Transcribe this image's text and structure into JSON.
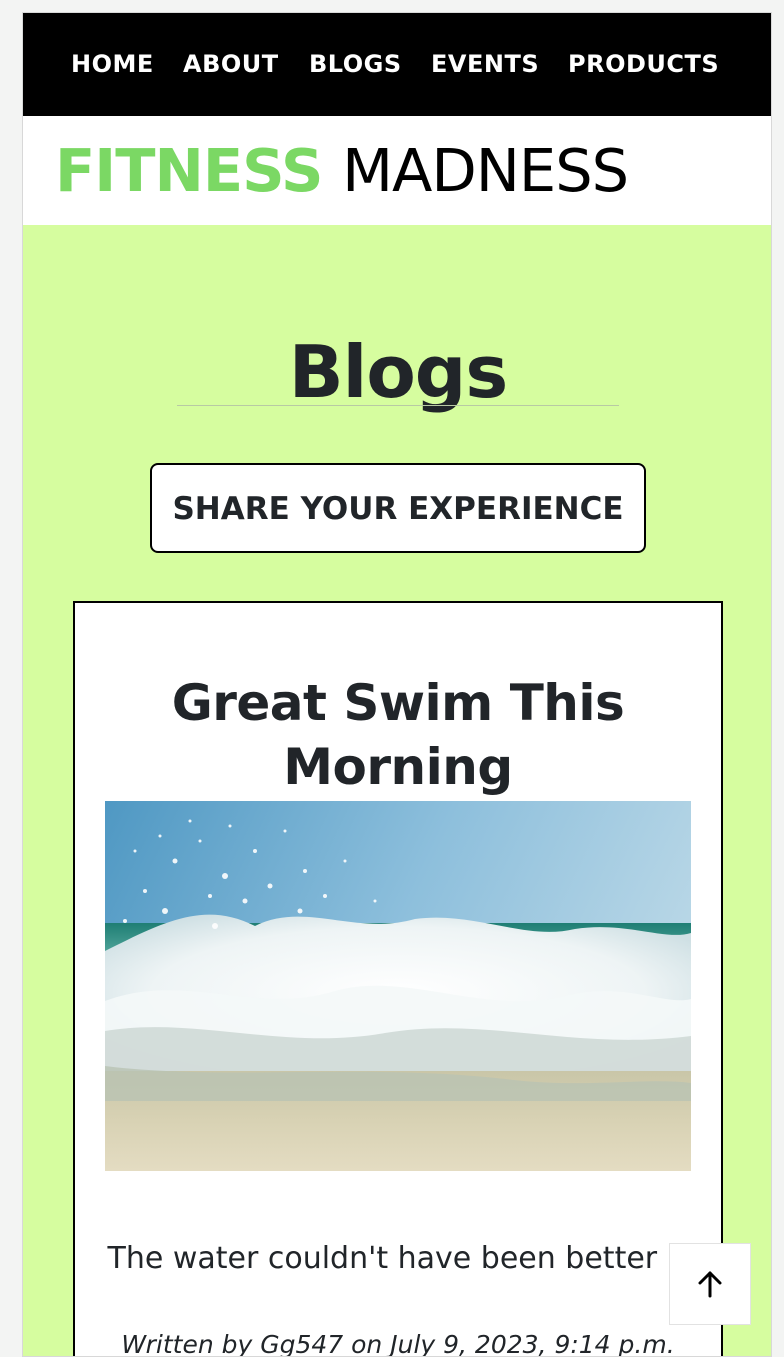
{
  "nav": {
    "items": [
      {
        "label": "HOME"
      },
      {
        "label": "ABOUT"
      },
      {
        "label": "BLOGS"
      },
      {
        "label": "EVENTS"
      },
      {
        "label": "PRODUCTS"
      }
    ]
  },
  "brand": {
    "part1": "FITNESS",
    "part2": "MADNESS",
    "accent_color": "#7bd864"
  },
  "page": {
    "title": "Blogs",
    "background_color": "#d6fd9f"
  },
  "actions": {
    "share_label": "SHARE YOUR EXPERIENCE"
  },
  "post": {
    "title": "Great Swim This Morning",
    "image_icon": "ocean-wave-photo",
    "body": "The water couldn't have been better :)",
    "meta": "Written by Gg547 on July 9, 2023, 9:14 p.m."
  },
  "back_to_top": {
    "icon": "arrow-up-icon"
  }
}
